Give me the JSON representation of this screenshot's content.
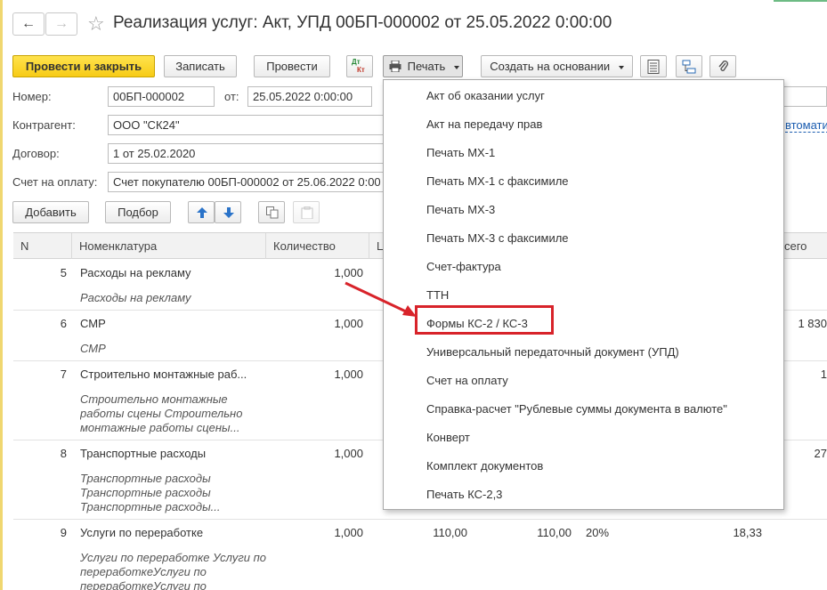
{
  "window": {
    "title": "Реализация услуг: Акт, УПД 00БП-000002 от 25.05.2022 0:00:00",
    "back_icon": "←",
    "forward_icon": "→",
    "star_icon": "☆"
  },
  "toolbar": {
    "post_close": "Провести и закрыть",
    "save": "Записать",
    "post": "Провести",
    "dtkt_top": "Дт",
    "dtkt_bottom": "Кт",
    "print": "Печать",
    "create_based": "Создать на основании"
  },
  "form": {
    "number_label": "Номер:",
    "number_value": "00БП-000002",
    "date_label": "от:",
    "date_value": "25.05.2022  0:00:00",
    "counterparty_label": "Контрагент:",
    "counterparty_value": "ООО \"СК24\"",
    "contract_label": "Договор:",
    "contract_value": "1 от 25.02.2020",
    "invoice_label": "Счет на оплату:",
    "invoice_value": "Счет покупателю 00БП-000002 от 25.06.2022 0:00",
    "auto_link": "втомати"
  },
  "table_toolbar": {
    "add": "Добавить",
    "pick": "Подбор"
  },
  "table": {
    "columns": [
      "N",
      "Номенклатура",
      "Количество",
      "Ц",
      "сего"
    ],
    "rows": [
      {
        "n": "5",
        "name": "Расходы на рекламу",
        "sub": "Расходы на рекламу",
        "qty": "1,000",
        "price": "",
        "sum": "",
        "vat": "",
        "vat_sum": "",
        "total": ""
      },
      {
        "n": "6",
        "name": "СМР",
        "sub": "СМР",
        "qty": "1,000",
        "price": "",
        "sum": "",
        "vat": "",
        "vat_sum": "",
        "total": "1 830"
      },
      {
        "n": "7",
        "name": "Строительно монтажные раб...",
        "sub": "Строительно монтажные работы сцены Строительно монтажные работы сцены...",
        "qty": "1,000",
        "price": "",
        "sum": "",
        "vat": "",
        "vat_sum": "",
        "total": "1"
      },
      {
        "n": "8",
        "name": "Транспортные расходы",
        "sub": "Транспортные расходы Транспортные расходы Транспортные расходы...",
        "qty": "1,000",
        "price": "",
        "sum": "",
        "vat": "",
        "vat_sum": "",
        "total": "27"
      },
      {
        "n": "9",
        "name": "Услуги по переработке",
        "sub": "Услуги по переработке Услуги по переработкеУслуги по переработкеУслуги по",
        "qty": "1,000",
        "price": "110,00",
        "sum": "110,00",
        "vat": "20%",
        "vat_sum": "18,33",
        "total": ""
      }
    ]
  },
  "print_menu": {
    "items": [
      "Акт об оказании услуг",
      "Акт на передачу прав",
      "Печать МХ-1",
      "Печать МХ-1 с факсимиле",
      "Печать МХ-3",
      "Печать МХ-3 с факсимиле",
      "Счет-фактура",
      "ТТН",
      "Формы КС-2 / КС-3",
      "Универсальный передаточный документ (УПД)",
      "Счет на оплату",
      "Справка-расчет \"Рублевые суммы документа в валюте\"",
      "Конверт",
      "Комплект документов",
      "Печать КС-2,3"
    ],
    "highlighted_index": 8
  },
  "colors": {
    "primary_button": "#f7cb16",
    "highlight_box": "#d8232a",
    "arrow": "#d8232a",
    "link": "#1a5cb0"
  }
}
